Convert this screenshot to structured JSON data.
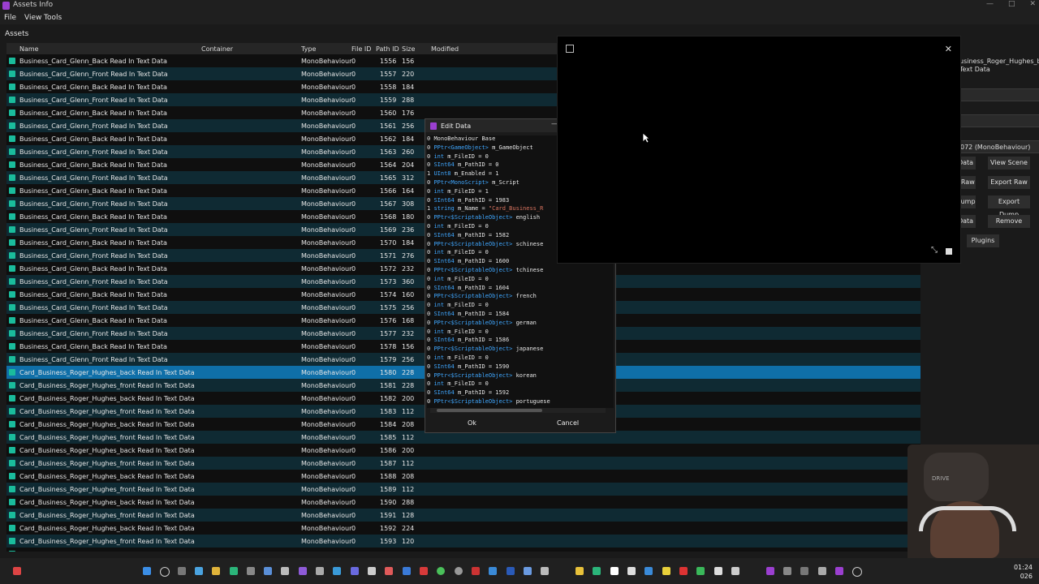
{
  "window": {
    "title": "Assets Info",
    "min": "—",
    "max": "□",
    "close": "✕"
  },
  "menu": [
    "File",
    "View",
    "Tools"
  ],
  "assets_label": "Assets",
  "columns": {
    "name": "Name",
    "container": "Container",
    "type": "Type",
    "file_id": "File ID",
    "path_id": "Path ID",
    "size": "Size",
    "modified": "Modified"
  },
  "rows": [
    {
      "name": "Business_Card_Glenn_Back Read In Text Data",
      "type": "MonoBehaviour",
      "fid": "0",
      "pid": "1556",
      "size": "156"
    },
    {
      "name": "Business_Card_Glenn_Front Read In Text Data",
      "type": "MonoBehaviour",
      "fid": "0",
      "pid": "1557",
      "size": "220"
    },
    {
      "name": "Business_Card_Glenn_Back Read In Text Data",
      "type": "MonoBehaviour",
      "fid": "0",
      "pid": "1558",
      "size": "184"
    },
    {
      "name": "Business_Card_Glenn_Front Read In Text Data",
      "type": "MonoBehaviour",
      "fid": "0",
      "pid": "1559",
      "size": "288"
    },
    {
      "name": "Business_Card_Glenn_Back Read In Text Data",
      "type": "MonoBehaviour",
      "fid": "0",
      "pid": "1560",
      "size": "176"
    },
    {
      "name": "Business_Card_Glenn_Front Read In Text Data",
      "type": "MonoBehaviour",
      "fid": "0",
      "pid": "1561",
      "size": "256"
    },
    {
      "name": "Business_Card_Glenn_Back Read In Text Data",
      "type": "MonoBehaviour",
      "fid": "0",
      "pid": "1562",
      "size": "184"
    },
    {
      "name": "Business_Card_Glenn_Front Read In Text Data",
      "type": "MonoBehaviour",
      "fid": "0",
      "pid": "1563",
      "size": "260"
    },
    {
      "name": "Business_Card_Glenn_Back Read In Text Data",
      "type": "MonoBehaviour",
      "fid": "0",
      "pid": "1564",
      "size": "204"
    },
    {
      "name": "Business_Card_Glenn_Front Read In Text Data",
      "type": "MonoBehaviour",
      "fid": "0",
      "pid": "1565",
      "size": "312"
    },
    {
      "name": "Business_Card_Glenn_Back Read In Text Data",
      "type": "MonoBehaviour",
      "fid": "0",
      "pid": "1566",
      "size": "164"
    },
    {
      "name": "Business_Card_Glenn_Front Read In Text Data",
      "type": "MonoBehaviour",
      "fid": "0",
      "pid": "1567",
      "size": "308"
    },
    {
      "name": "Business_Card_Glenn_Back Read In Text Data",
      "type": "MonoBehaviour",
      "fid": "0",
      "pid": "1568",
      "size": "180"
    },
    {
      "name": "Business_Card_Glenn_Front Read In Text Data",
      "type": "MonoBehaviour",
      "fid": "0",
      "pid": "1569",
      "size": "236"
    },
    {
      "name": "Business_Card_Glenn_Back Read In Text Data",
      "type": "MonoBehaviour",
      "fid": "0",
      "pid": "1570",
      "size": "184"
    },
    {
      "name": "Business_Card_Glenn_Front Read In Text Data",
      "type": "MonoBehaviour",
      "fid": "0",
      "pid": "1571",
      "size": "276"
    },
    {
      "name": "Business_Card_Glenn_Back Read In Text Data",
      "type": "MonoBehaviour",
      "fid": "0",
      "pid": "1572",
      "size": "232"
    },
    {
      "name": "Business_Card_Glenn_Front Read In Text Data",
      "type": "MonoBehaviour",
      "fid": "0",
      "pid": "1573",
      "size": "360"
    },
    {
      "name": "Business_Card_Glenn_Back Read In Text Data",
      "type": "MonoBehaviour",
      "fid": "0",
      "pid": "1574",
      "size": "160"
    },
    {
      "name": "Business_Card_Glenn_Front Read In Text Data",
      "type": "MonoBehaviour",
      "fid": "0",
      "pid": "1575",
      "size": "256"
    },
    {
      "name": "Business_Card_Glenn_Back Read In Text Data",
      "type": "MonoBehaviour",
      "fid": "0",
      "pid": "1576",
      "size": "168"
    },
    {
      "name": "Business_Card_Glenn_Front Read In Text Data",
      "type": "MonoBehaviour",
      "fid": "0",
      "pid": "1577",
      "size": "232"
    },
    {
      "name": "Business_Card_Glenn_Back Read In Text Data",
      "type": "MonoBehaviour",
      "fid": "0",
      "pid": "1578",
      "size": "156"
    },
    {
      "name": "Business_Card_Glenn_Front Read In Text Data",
      "type": "MonoBehaviour",
      "fid": "0",
      "pid": "1579",
      "size": "256"
    },
    {
      "name": "Card_Business_Roger_Hughes_back Read In Text Data",
      "type": "MonoBehaviour",
      "fid": "0",
      "pid": "1580",
      "size": "228",
      "selected": true
    },
    {
      "name": "Card_Business_Roger_Hughes_front Read In Text Data",
      "type": "MonoBehaviour",
      "fid": "0",
      "pid": "1581",
      "size": "228"
    },
    {
      "name": "Card_Business_Roger_Hughes_back Read In Text Data",
      "type": "MonoBehaviour",
      "fid": "0",
      "pid": "1582",
      "size": "200"
    },
    {
      "name": "Card_Business_Roger_Hughes_front Read In Text Data",
      "type": "MonoBehaviour",
      "fid": "0",
      "pid": "1583",
      "size": "112"
    },
    {
      "name": "Card_Business_Roger_Hughes_back Read In Text Data",
      "type": "MonoBehaviour",
      "fid": "0",
      "pid": "1584",
      "size": "208"
    },
    {
      "name": "Card_Business_Roger_Hughes_front Read In Text Data",
      "type": "MonoBehaviour",
      "fid": "0",
      "pid": "1585",
      "size": "112"
    },
    {
      "name": "Card_Business_Roger_Hughes_back Read In Text Data",
      "type": "MonoBehaviour",
      "fid": "0",
      "pid": "1586",
      "size": "200"
    },
    {
      "name": "Card_Business_Roger_Hughes_front Read In Text Data",
      "type": "MonoBehaviour",
      "fid": "0",
      "pid": "1587",
      "size": "112"
    },
    {
      "name": "Card_Business_Roger_Hughes_back Read In Text Data",
      "type": "MonoBehaviour",
      "fid": "0",
      "pid": "1588",
      "size": "208"
    },
    {
      "name": "Card_Business_Roger_Hughes_front Read In Text Data",
      "type": "MonoBehaviour",
      "fid": "0",
      "pid": "1589",
      "size": "112"
    },
    {
      "name": "Card_Business_Roger_Hughes_back Read In Text Data",
      "type": "MonoBehaviour",
      "fid": "0",
      "pid": "1590",
      "size": "288"
    },
    {
      "name": "Card_Business_Roger_Hughes_front Read In Text Data",
      "type": "MonoBehaviour",
      "fid": "0",
      "pid": "1591",
      "size": "128"
    },
    {
      "name": "Card_Business_Roger_Hughes_back Read In Text Data",
      "type": "MonoBehaviour",
      "fid": "0",
      "pid": "1592",
      "size": "224"
    },
    {
      "name": "Card_Business_Roger_Hughes_front Read In Text Data",
      "type": "MonoBehaviour",
      "fid": "0",
      "pid": "1593",
      "size": "120"
    },
    {
      "name": "Card_Business_Roger_Hughes_back Read In Text Data",
      "type": "MonoBehaviour",
      "fid": "0",
      "pid": "1594",
      "size": "224"
    }
  ],
  "right_panel": {
    "name_line1": "usiness_Roger_Hughes_ba",
    "name_line2": "Text Data",
    "type_value": "072 (MonoBehaviour)",
    "buttons": [
      "Data",
      "View Scene",
      "t Raw",
      "Export Raw",
      "Dump",
      "Export Dump",
      "Data",
      "Remove",
      "Plugins"
    ]
  },
  "edit_dialog": {
    "title": "Edit Data",
    "min": "—",
    "ok": "Ok",
    "cancel": "Cancel",
    "lines": [
      [
        [
          "n",
          "0 "
        ],
        [
          "n",
          "MonoBehaviour Base"
        ]
      ],
      [
        [
          "n",
          " 0 "
        ],
        [
          "k",
          "PPtr<GameObject>"
        ],
        [
          "n",
          " m_GameObject"
        ]
      ],
      [
        [
          "n",
          "  0 "
        ],
        [
          "k",
          "int"
        ],
        [
          "n",
          " m_FileID = 0"
        ]
      ],
      [
        [
          "n",
          "  0 "
        ],
        [
          "k",
          "SInt64"
        ],
        [
          "n",
          " m_PathID = 0"
        ]
      ],
      [
        [
          "n",
          " 1 "
        ],
        [
          "k",
          "UInt8"
        ],
        [
          "n",
          " m_Enabled = 1"
        ]
      ],
      [
        [
          "n",
          " 0 "
        ],
        [
          "k",
          "PPtr<MonoScript>"
        ],
        [
          "n",
          " m_Script"
        ]
      ],
      [
        [
          "n",
          "  0 "
        ],
        [
          "k",
          "int"
        ],
        [
          "n",
          " m_FileID = 1"
        ]
      ],
      [
        [
          "n",
          "  0 "
        ],
        [
          "k",
          "SInt64"
        ],
        [
          "n",
          " m_PathID = 1983"
        ]
      ],
      [
        [
          "n",
          " 1 "
        ],
        [
          "k",
          "string"
        ],
        [
          "n",
          " m_Name = "
        ],
        [
          "s",
          "\"Card_Business_R"
        ]
      ],
      [
        [
          "n",
          " 0 "
        ],
        [
          "k",
          "PPtr<$ScriptableObject>"
        ],
        [
          "n",
          " english"
        ]
      ],
      [
        [
          "n",
          "  0 "
        ],
        [
          "k",
          "int"
        ],
        [
          "n",
          " m_FileID = 0"
        ]
      ],
      [
        [
          "n",
          "  0 "
        ],
        [
          "k",
          "SInt64"
        ],
        [
          "n",
          " m_PathID = 1582"
        ]
      ],
      [
        [
          "n",
          " 0 "
        ],
        [
          "k",
          "PPtr<$ScriptableObject>"
        ],
        [
          "n",
          " schinese"
        ]
      ],
      [
        [
          "n",
          "  0 "
        ],
        [
          "k",
          "int"
        ],
        [
          "n",
          " m_FileID = 0"
        ]
      ],
      [
        [
          "n",
          "  0 "
        ],
        [
          "k",
          "SInt64"
        ],
        [
          "n",
          " m_PathID = 1600"
        ]
      ],
      [
        [
          "n",
          " 0 "
        ],
        [
          "k",
          "PPtr<$ScriptableObject>"
        ],
        [
          "n",
          " tchinese"
        ]
      ],
      [
        [
          "n",
          "  0 "
        ],
        [
          "k",
          "int"
        ],
        [
          "n",
          " m_FileID = 0"
        ]
      ],
      [
        [
          "n",
          "  0 "
        ],
        [
          "k",
          "SInt64"
        ],
        [
          "n",
          " m_PathID = 1604"
        ]
      ],
      [
        [
          "n",
          " 0 "
        ],
        [
          "k",
          "PPtr<$ScriptableObject>"
        ],
        [
          "n",
          " french"
        ]
      ],
      [
        [
          "n",
          "  0 "
        ],
        [
          "k",
          "int"
        ],
        [
          "n",
          " m_FileID = 0"
        ]
      ],
      [
        [
          "n",
          "  0 "
        ],
        [
          "k",
          "SInt64"
        ],
        [
          "n",
          " m_PathID = 1584"
        ]
      ],
      [
        [
          "n",
          " 0 "
        ],
        [
          "k",
          "PPtr<$ScriptableObject>"
        ],
        [
          "n",
          " german"
        ]
      ],
      [
        [
          "n",
          "  0 "
        ],
        [
          "k",
          "int"
        ],
        [
          "n",
          " m_FileID = 0"
        ]
      ],
      [
        [
          "n",
          "  0 "
        ],
        [
          "k",
          "SInt64"
        ],
        [
          "n",
          " m_PathID = 1586"
        ]
      ],
      [
        [
          "n",
          " 0 "
        ],
        [
          "k",
          "PPtr<$ScriptableObject>"
        ],
        [
          "n",
          " japanese"
        ]
      ],
      [
        [
          "n",
          "  0 "
        ],
        [
          "k",
          "int"
        ],
        [
          "n",
          " m_FileID = 0"
        ]
      ],
      [
        [
          "n",
          "  0 "
        ],
        [
          "k",
          "SInt64"
        ],
        [
          "n",
          " m_PathID = 1590"
        ]
      ],
      [
        [
          "n",
          " 0 "
        ],
        [
          "k",
          "PPtr<$ScriptableObject>"
        ],
        [
          "n",
          " korean"
        ]
      ],
      [
        [
          "n",
          "  0 "
        ],
        [
          "k",
          "int"
        ],
        [
          "n",
          " m_FileID = 0"
        ]
      ],
      [
        [
          "n",
          "  0 "
        ],
        [
          "k",
          "SInt64"
        ],
        [
          "n",
          " m_PathID = 1592"
        ]
      ],
      [
        [
          "n",
          " 0 "
        ],
        [
          "k",
          "PPtr<$ScriptableObject>"
        ],
        [
          "n",
          " portuguese"
        ]
      ]
    ]
  },
  "preview": {
    "close": "✕",
    "crop": "⤡"
  },
  "webcam_brand": "DRIVE",
  "clock": {
    "time": "01:24",
    "date": "026"
  },
  "colors": {
    "accent_row": "#0f2a33",
    "selected_row": "#0f6fa8",
    "text_keyword": "#3fa7ff",
    "text_string": "#d9735f"
  }
}
